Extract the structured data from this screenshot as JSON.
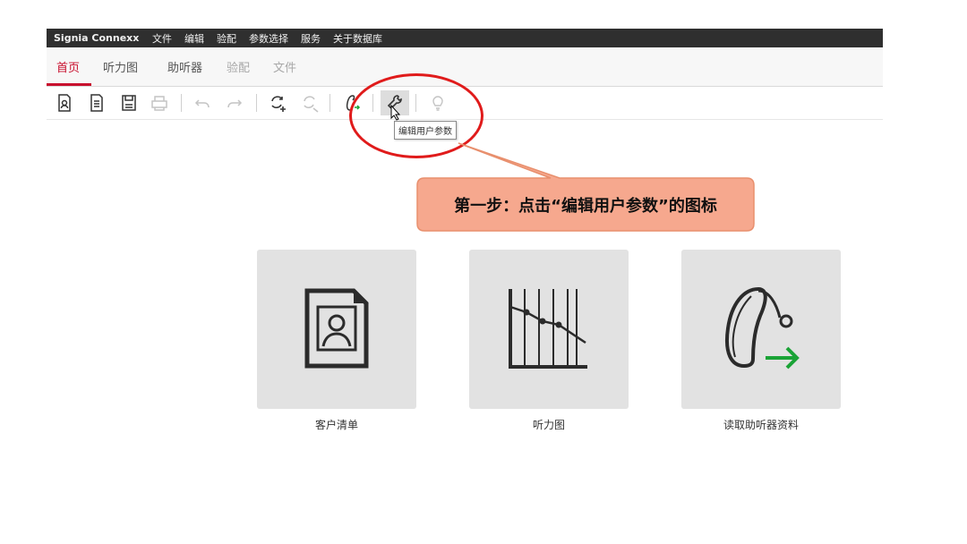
{
  "titlebar": {
    "app_name": "Signia Connexx",
    "menu": [
      "文件",
      "编辑",
      "验配",
      "参数选择",
      "服务",
      "关于数据库"
    ]
  },
  "tabs": [
    {
      "label": "首页",
      "state": "active"
    },
    {
      "label": "听力图",
      "state": "enabled"
    },
    {
      "label": "助听器",
      "state": "enabled"
    },
    {
      "label": "验配",
      "state": "disabled"
    },
    {
      "label": "文件",
      "state": "disabled"
    }
  ],
  "toolbar": {
    "icons": [
      "client-card-icon",
      "document-icon",
      "save-icon",
      "print-icon",
      "undo-icon",
      "redo-icon",
      "connect-refresh-icon",
      "disconnect-icon",
      "hearing-aid-icon",
      "wrench-icon",
      "lightbulb-icon"
    ],
    "tooltip": "编辑用户参数"
  },
  "annotation": {
    "text": "第一步：点击“编辑用户参数”的图标",
    "ellipse_color": "#e01b1b",
    "callout_fill": "#f6a88e",
    "callout_border": "#e88f6d"
  },
  "tiles": [
    {
      "label": "客户清单",
      "icon": "client-document-icon"
    },
    {
      "label": "听力图",
      "icon": "audiogram-icon"
    },
    {
      "label": "读取助听器资料",
      "icon": "hearing-aid-read-icon"
    }
  ],
  "colors": {
    "accent": "#c8102e",
    "titlebar_bg": "#2f2f2f",
    "tile_bg": "#e2e2e2",
    "arrow_green": "#1aa336"
  }
}
